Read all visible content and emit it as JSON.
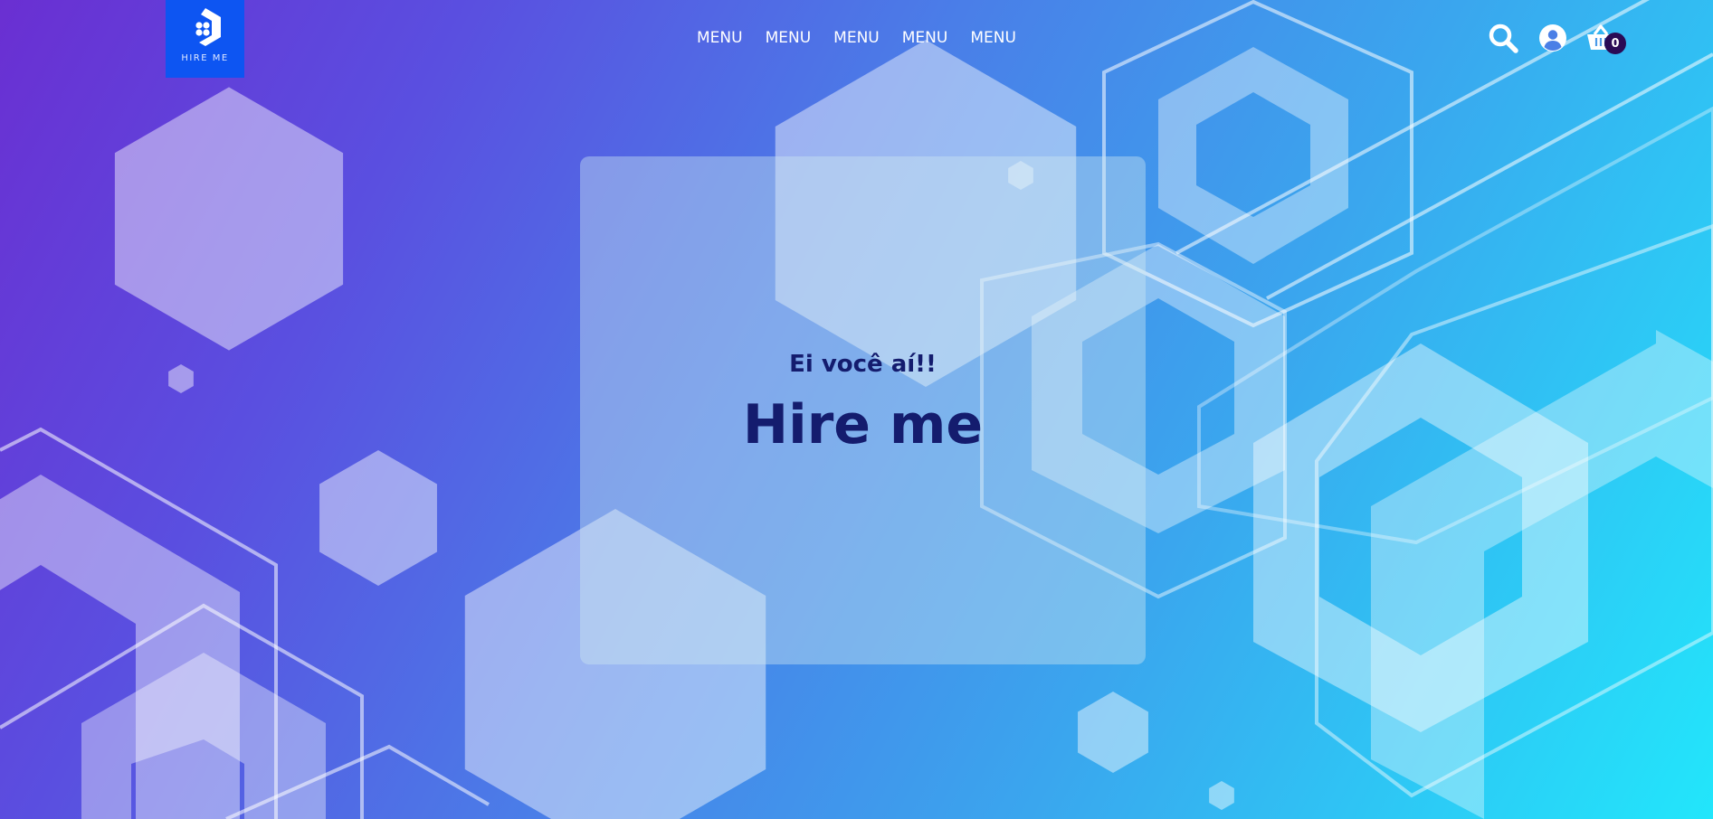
{
  "brand": {
    "logo_text": "HIRE ME",
    "logo_color": "#0d55f2"
  },
  "nav": {
    "items": [
      {
        "label": "MENU"
      },
      {
        "label": "MENU"
      },
      {
        "label": "MENU"
      },
      {
        "label": "MENU"
      },
      {
        "label": "MENU"
      }
    ]
  },
  "header_icons": {
    "search": "search-icon",
    "account": "user-circle-icon",
    "cart": "basket-icon",
    "cart_count": "0"
  },
  "hero": {
    "subtitle": "Ei você aí!!",
    "title": "Hire me",
    "text_color": "#141c6e"
  },
  "theme": {
    "gradient_start": "#6a2fd2",
    "gradient_end": "#22e6fb"
  }
}
